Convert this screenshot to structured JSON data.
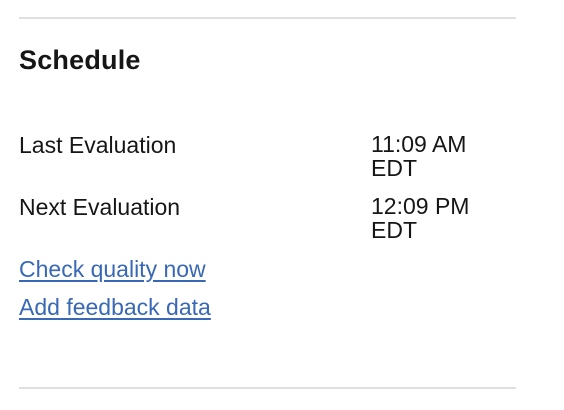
{
  "schedule": {
    "title": "Schedule",
    "rows": [
      {
        "label": "Last Evaluation",
        "time": "11:09 AM",
        "zone": "EDT"
      },
      {
        "label": "Next Evaluation",
        "time": "12:09 PM",
        "zone": "EDT"
      }
    ],
    "links": {
      "check_quality": "Check quality now",
      "add_feedback": "Add feedback data"
    }
  },
  "colors": {
    "text": "#161616",
    "link": "#3868b6",
    "divider": "#e0e0e0"
  }
}
